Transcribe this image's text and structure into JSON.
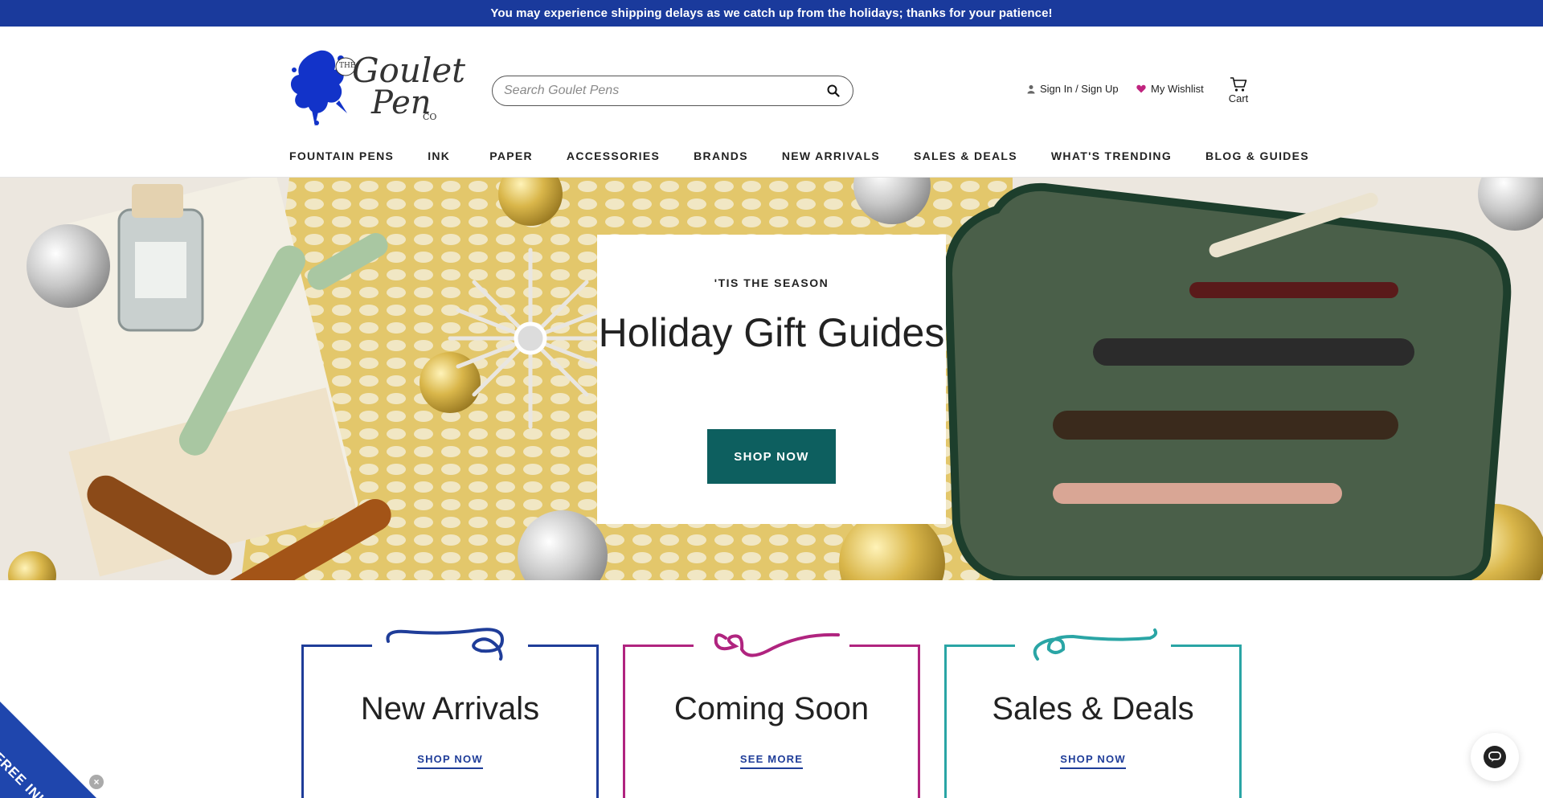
{
  "announcement": {
    "text": "You may experience shipping delays as we catch up from the holidays; thanks for your patience!"
  },
  "header": {
    "logo": {
      "the": "THE",
      "goulet": "Goulet",
      "pen": "Pen",
      "co": "CO"
    },
    "search": {
      "placeholder": "Search Goulet Pens",
      "icon": "search-icon"
    },
    "account_label": "Sign In / Sign Up",
    "wishlist_label": "My Wishlist",
    "cart_label": "Cart",
    "accent_color": "#c0247f"
  },
  "nav": {
    "items": [
      {
        "label": "FOUNTAIN PENS"
      },
      {
        "label": "INK"
      },
      {
        "label": "PAPER"
      },
      {
        "label": "ACCESSORIES"
      },
      {
        "label": "BRANDS"
      },
      {
        "label": "NEW ARRIVALS"
      },
      {
        "label": "SALES & DEALS"
      },
      {
        "label": "WHAT'S TRENDING"
      },
      {
        "label": "BLOG & GUIDES"
      }
    ]
  },
  "hero": {
    "eyebrow": "'TIS THE SEASON",
    "title": "Holiday Gift Guides",
    "button": "SHOP NOW",
    "button_color": "#0d5f5f"
  },
  "categories": [
    {
      "title": "New Arrivals",
      "link": "SHOP NOW",
      "color": "#1f3d99"
    },
    {
      "title": "Coming Soon",
      "link": "SEE MORE",
      "color": "#b0247f"
    },
    {
      "title": "Sales & Deals",
      "link": "SHOP NOW",
      "color": "#2aa5a5"
    }
  ],
  "free_ink": {
    "label": "FREE INK",
    "close": "×",
    "color": "#1f46ad"
  },
  "chat": {
    "icon": "chat-bubble-icon"
  },
  "colors": {
    "announcement_bg": "#1a3a9c",
    "text": "#222222"
  }
}
